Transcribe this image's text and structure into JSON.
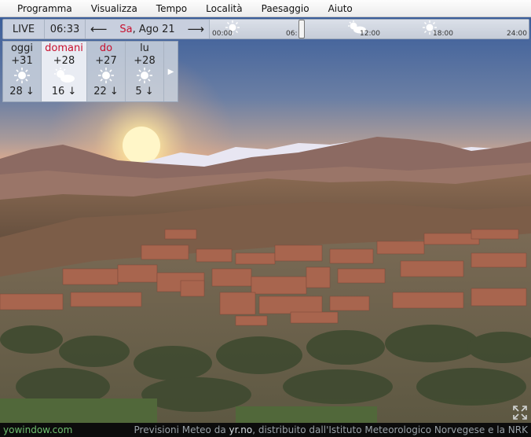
{
  "menu": {
    "items": [
      "Programma",
      "Visualizza",
      "Tempo",
      "Località",
      "Paesaggio",
      "Aiuto"
    ]
  },
  "timebar": {
    "live_label": "LIVE",
    "clock": "06:33",
    "date_dow": "Sa",
    "date_rest": ", Ago 21",
    "ticks": [
      "00:00",
      "06:",
      "12:00",
      "18:00",
      "24:00"
    ]
  },
  "forecast": {
    "days": [
      {
        "name": "oggi",
        "temp": "+31",
        "icon": "sun-icon",
        "wind": "28",
        "red": false,
        "selected": false
      },
      {
        "name": "domani",
        "temp": "+28",
        "icon": "partly-cloudy-icon",
        "wind": "16",
        "red": true,
        "selected": true
      },
      {
        "name": "do",
        "temp": "+27",
        "icon": "sun-icon",
        "wind": "22",
        "red": true,
        "selected": false
      },
      {
        "name": "lu",
        "temp": "+28",
        "icon": "sun-icon",
        "wind": "5",
        "red": false,
        "selected": false
      }
    ],
    "wind_arrow": "↓"
  },
  "footer": {
    "brand": "yowindow.com",
    "credits_pre": "Previsioni Meteo da ",
    "credits_link": "yr.no",
    "credits_post": ", distribuito dall'Istituto Meteorologico Norvegese e la NRK"
  }
}
